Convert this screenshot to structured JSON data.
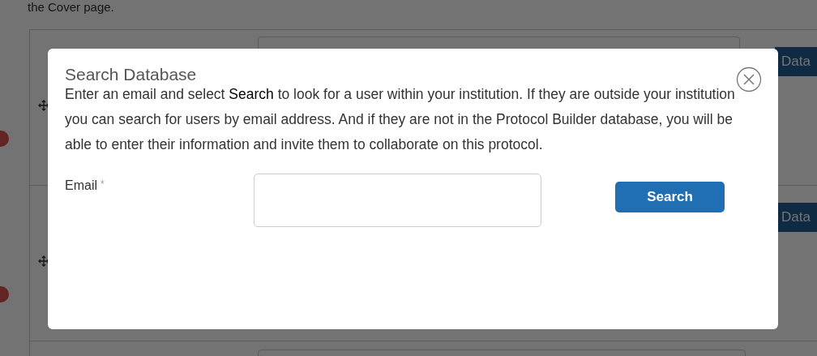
{
  "background": {
    "intro_text": "the Cover page.",
    "rows": [
      {
        "button": "Data"
      },
      {
        "button": "Data"
      }
    ]
  },
  "dialog": {
    "title": "Search Database",
    "description": "Enter an email and select **Search** to look for a user within your institution. If they are outside your institution you can search for users by email address. And if they are not in the Protocol Builder database, you will be able to enter their information and invite them to collaborate on this protocol.",
    "email_label": "Email",
    "required_mark": "*",
    "search_button": "Search"
  }
}
